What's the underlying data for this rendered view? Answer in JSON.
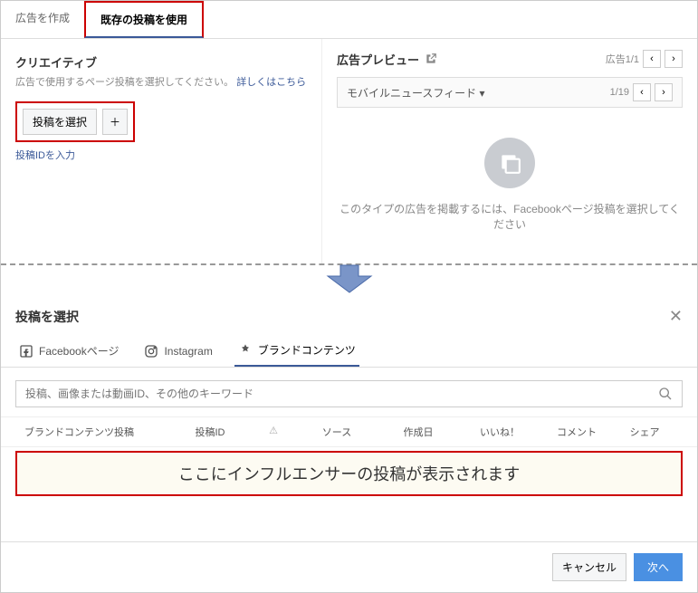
{
  "tabs": {
    "create": "広告を作成",
    "existing": "既存の投稿を使用"
  },
  "creative": {
    "title": "クリエイティブ",
    "desc": "広告で使用するページ投稿を選択してください。",
    "more": "詳しくはこちら",
    "select_btn": "投稿を選択",
    "add_btn": "＋",
    "id_link": "投稿IDを入力"
  },
  "preview": {
    "title": "広告プレビュー",
    "count": "広告1/1",
    "feed": "モバイルニュースフィード ▾",
    "page": "1/19",
    "message": "このタイプの広告を掲載するには、Facebookページ投稿を選択してください"
  },
  "selectPost": {
    "title": "投稿を選択",
    "tabs": {
      "fb": "Facebookページ",
      "ig": "Instagram",
      "brand": "ブランドコンテンツ"
    },
    "search_placeholder": "投稿、画像または動画ID、その他のキーワード",
    "columns": {
      "post": "ブランドコンテンツ投稿",
      "id": "投稿ID",
      "warn": "⚠",
      "source": "ソース",
      "date": "作成日",
      "likes": "いいね！",
      "comments": "コメント",
      "shares": "シェア"
    },
    "result_note": "ここにインフルエンサーの投稿が表示されます"
  },
  "footer": {
    "cancel": "キャンセル",
    "next": "次へ"
  }
}
